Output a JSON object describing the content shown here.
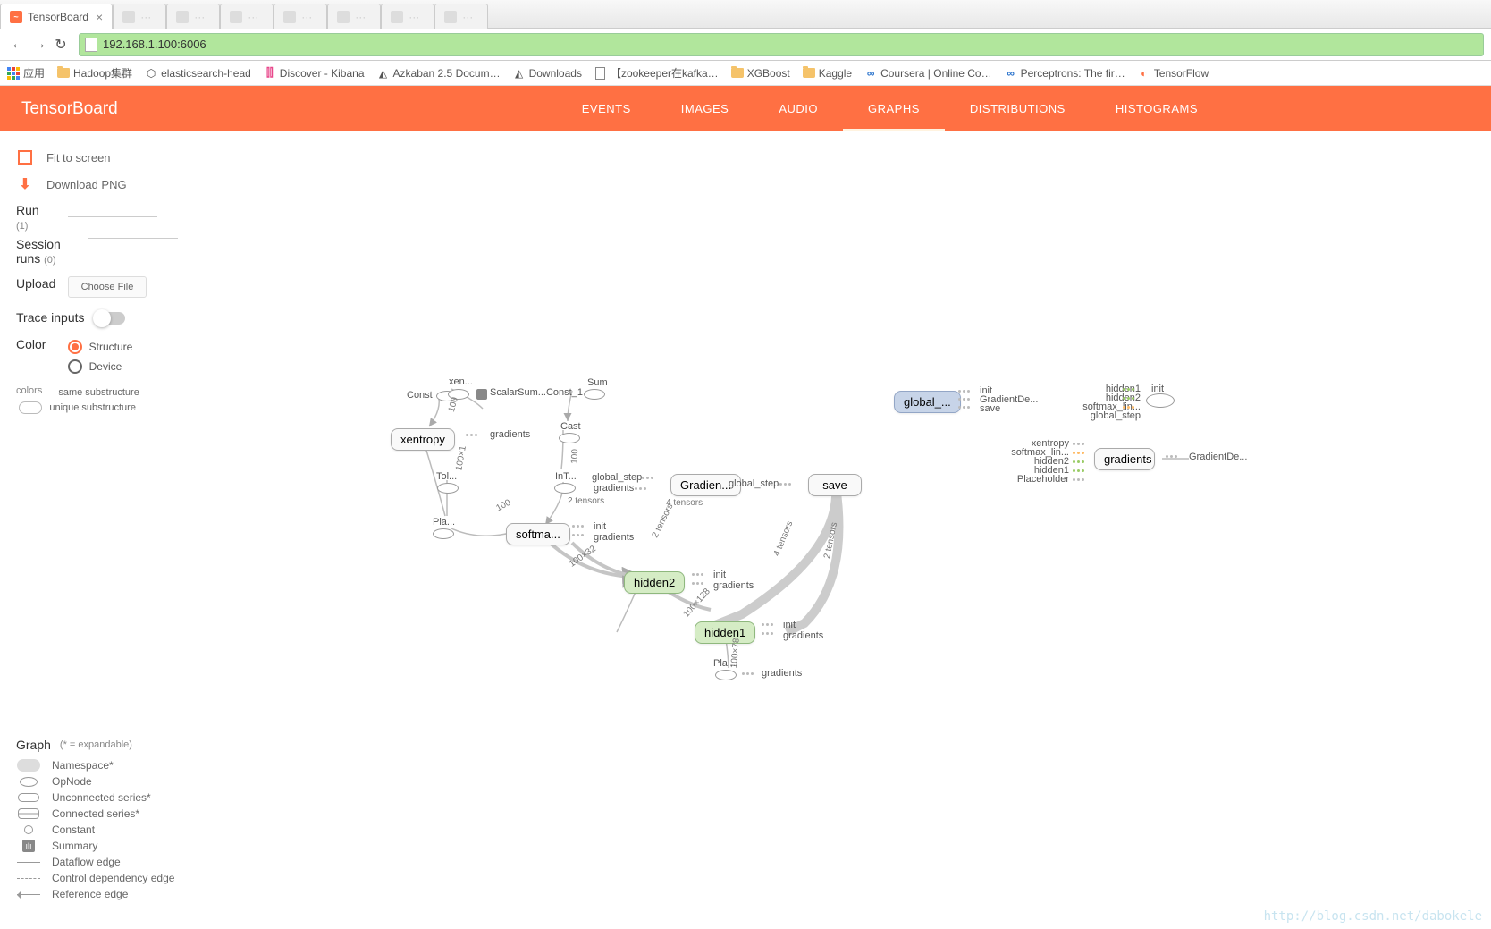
{
  "browser": {
    "active_tab": "TensorBoard",
    "url": "192.168.1.100:6006",
    "nav": {
      "back": "←",
      "forward": "→",
      "reload": "↻"
    },
    "bookmarks": {
      "apps": "应用",
      "items": [
        "Hadoop集群",
        "elasticsearch-head",
        "Discover - Kibana",
        "Azkaban 2.5 Docum…",
        "Downloads",
        "【zookeeper在kafka…",
        "XGBoost",
        "Kaggle",
        "Coursera | Online Co…",
        "Perceptrons: The fir…",
        "TensorFlow"
      ]
    }
  },
  "header": {
    "logo": "TensorBoard",
    "nav": [
      "EVENTS",
      "IMAGES",
      "AUDIO",
      "GRAPHS",
      "DISTRIBUTIONS",
      "HISTOGRAMS"
    ],
    "active": "GRAPHS"
  },
  "sidebar": {
    "fit": "Fit to screen",
    "download": "Download PNG",
    "run_label": "Run",
    "run_count": "(1)",
    "session_label": "Session runs",
    "session_count": "(0)",
    "upload_label": "Upload",
    "choose_file": "Choose File",
    "trace_label": "Trace inputs",
    "color_label": "Color",
    "color_opts": [
      "Structure",
      "Device"
    ],
    "colors_hdr": "colors",
    "colors_items": [
      "same substructure",
      "unique substructure"
    ]
  },
  "legend": {
    "title": "Graph",
    "note": "(* = expandable)",
    "items": [
      "Namespace*",
      "OpNode",
      "Unconnected series*",
      "Connected series*",
      "Constant",
      "Summary",
      "Dataflow edge",
      "Control dependency edge",
      "Reference edge"
    ]
  },
  "graph": {
    "nodes": {
      "xentropy": "xentropy",
      "softmax": "softma...",
      "hidden2": "hidden2",
      "hidden1": "hidden1",
      "gradien": "Gradien...",
      "save": "save",
      "global": "global_...",
      "gradients_box": "gradients"
    },
    "labels": {
      "const": "Const",
      "xen": "xen...",
      "scalar": "ScalarSum...Const_1",
      "sum": "Sum",
      "cast": "Cast",
      "tol": "Tol...",
      "int": "InT...",
      "pla": "Pla...",
      "global_step": "global_step",
      "two_tensors": "2 tensors",
      "four_tensors": "4 tensors",
      "init": "init",
      "gradients": "gradients",
      "gradientde": "GradientDe...",
      "save_l": "save",
      "hidden1_l": "hidden1",
      "hidden2_l": "hidden2",
      "softmax_lin": "softmax_lin...",
      "global_step_l": "global_step",
      "xentropy_l": "xentropy",
      "placeholder": "Placeholder",
      "pla2": "Pla...",
      "n100": "100",
      "n100x128": "100×128",
      "n100x32": "100×32",
      "n100x1": "100×1",
      "n100x78": "100×78"
    }
  },
  "watermark": "http://blog.csdn.net/dabokele"
}
